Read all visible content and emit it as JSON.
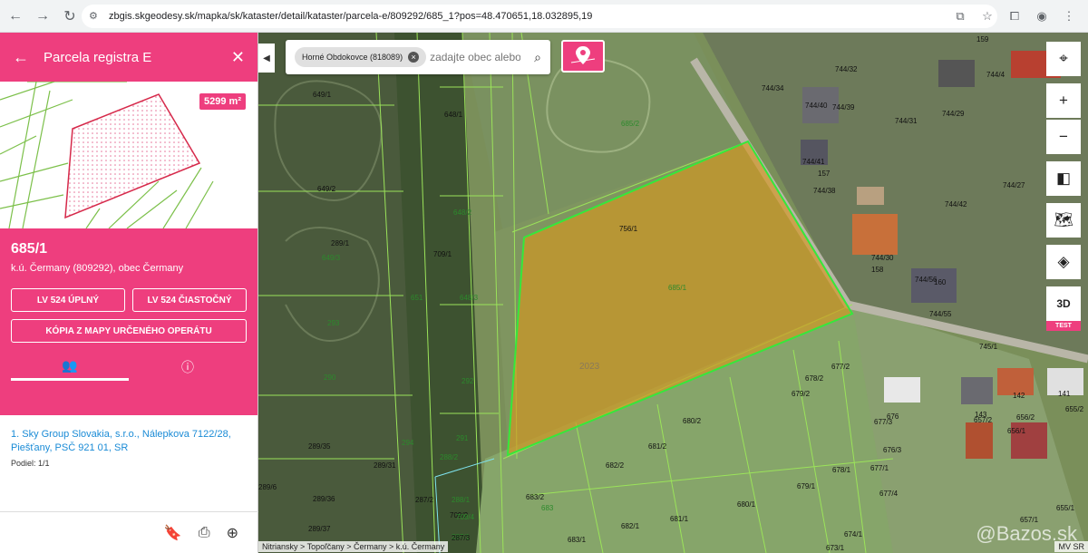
{
  "browser": {
    "url": "zbgis.skgeodesy.sk/mapka/sk/kataster/detail/kataster/parcela-e/809292/685_1?pos=48.470651,18.032895,19"
  },
  "sidebar": {
    "title": "Parcela registra E",
    "area_badge": "5299 m²",
    "parcel_number": "685/1",
    "location": "k.ú. Čermany (809292), obec Čermany",
    "btn_lv_full": "LV 524 ÚPLNÝ",
    "btn_lv_partial": "LV 524 ČIASTOČNÝ",
    "btn_copy": "KÓPIA Z MAPY URČENÉHO OPERÁTU",
    "owner": "1. Sky Group Slovakia, s.r.o., Nálepkova 7122/28, Piešťany, PSČ 921 01, SR",
    "share": "Podiel: 1/1"
  },
  "map": {
    "search_chip": "Horné Obdokovce (818089)",
    "search_placeholder": "zadajte obec alebo",
    "tool_3d": "3D",
    "test_label": "TEST",
    "breadcrumb": "Nitriansky > Topoľčany > Čermany > k.ú. Čermany",
    "attribution": "MV SR",
    "watermark": "@Bazos.sk",
    "year_label": "2023",
    "parcel_labels": [
      {
        "text": "649/1",
        "g": false
      },
      {
        "text": "648/1",
        "g": false
      },
      {
        "text": "649/2",
        "g": false
      },
      {
        "text": "685/2",
        "g": true
      },
      {
        "text": "756/1",
        "g": false
      },
      {
        "text": "648/2",
        "g": true
      },
      {
        "text": "709/1",
        "g": false
      },
      {
        "text": "649/3",
        "g": true
      },
      {
        "text": "289/1",
        "g": false
      },
      {
        "text": "648/3",
        "g": true
      },
      {
        "text": "685/1",
        "g": true
      },
      {
        "text": "293",
        "g": true
      },
      {
        "text": "651",
        "g": true
      },
      {
        "text": "290",
        "g": true
      },
      {
        "text": "292",
        "g": true
      },
      {
        "text": "678/2",
        "g": false
      },
      {
        "text": "679/2",
        "g": false
      },
      {
        "text": "680/2",
        "g": false
      },
      {
        "text": "677/2",
        "g": false
      },
      {
        "text": "677/3",
        "g": false
      },
      {
        "text": "681/2",
        "g": false
      },
      {
        "text": "676",
        "g": false
      },
      {
        "text": "289/35",
        "g": false
      },
      {
        "text": "294",
        "g": true
      },
      {
        "text": "291",
        "g": true
      },
      {
        "text": "682/2",
        "g": false
      },
      {
        "text": "678/1",
        "g": false
      },
      {
        "text": "677/1",
        "g": false
      },
      {
        "text": "679/1",
        "g": false
      },
      {
        "text": "289/31",
        "g": false
      },
      {
        "text": "289/6",
        "g": false
      },
      {
        "text": "289/36",
        "g": false
      },
      {
        "text": "287/2",
        "g": false
      },
      {
        "text": "288/1",
        "g": true
      },
      {
        "text": "683/2",
        "g": false
      },
      {
        "text": "683",
        "g": true
      },
      {
        "text": "680/1",
        "g": false
      },
      {
        "text": "677/4",
        "g": false
      },
      {
        "text": "709/2",
        "g": false
      },
      {
        "text": "682/1",
        "g": false
      },
      {
        "text": "681/1",
        "g": false
      },
      {
        "text": "289/37",
        "g": false
      },
      {
        "text": "287/1",
        "g": true
      },
      {
        "text": "683/1",
        "g": false
      },
      {
        "text": "674/1",
        "g": false
      },
      {
        "text": "673/1",
        "g": false
      },
      {
        "text": "159",
        "g": false
      },
      {
        "text": "744/32",
        "g": false
      },
      {
        "text": "744/34",
        "g": false
      },
      {
        "text": "744/40",
        "g": false
      },
      {
        "text": "744/39",
        "g": false
      },
      {
        "text": "744/31",
        "g": false
      },
      {
        "text": "744/29",
        "g": false
      },
      {
        "text": "744/41",
        "g": false
      },
      {
        "text": "157",
        "g": false
      },
      {
        "text": "744/38",
        "g": false
      },
      {
        "text": "744/27",
        "g": false
      },
      {
        "text": "744/42",
        "g": false
      },
      {
        "text": "744/30",
        "g": false
      },
      {
        "text": "158",
        "g": false
      },
      {
        "text": "744/56",
        "g": false
      },
      {
        "text": "160",
        "g": false
      },
      {
        "text": "744/55",
        "g": false
      },
      {
        "text": "745/1",
        "g": false
      },
      {
        "text": "142",
        "g": false
      },
      {
        "text": "141",
        "g": false
      },
      {
        "text": "657/2",
        "g": false
      },
      {
        "text": "656/2",
        "g": false
      },
      {
        "text": "655/2",
        "g": false
      },
      {
        "text": "143",
        "g": false
      },
      {
        "text": "656/1",
        "g": false
      },
      {
        "text": "655/1",
        "g": false
      },
      {
        "text": "657/1",
        "g": false
      },
      {
        "text": "744/4",
        "g": false
      },
      {
        "text": "648/5",
        "g": true
      },
      {
        "text": "709/4",
        "g": true
      },
      {
        "text": "287/3",
        "g": false
      },
      {
        "text": "676/3",
        "g": false
      },
      {
        "text": "288/2",
        "g": true
      }
    ]
  }
}
